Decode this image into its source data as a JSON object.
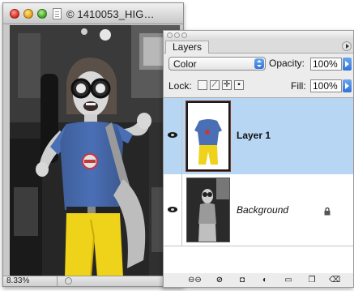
{
  "document": {
    "title": "© 1410053_HIG…",
    "zoom": "8.33%"
  },
  "layers_panel": {
    "tab_label": "Layers",
    "blend_mode": "Color",
    "opacity_label": "Opacity:",
    "opacity_value": "100%",
    "lock_label": "Lock:",
    "fill_label": "Fill:",
    "fill_value": "100%",
    "layers": [
      {
        "name": "Layer 1",
        "selected": true,
        "visible": true
      },
      {
        "name": "Background",
        "selected": false,
        "visible": true,
        "locked": true
      }
    ],
    "footer_buttons": [
      "link-layers",
      "layer-style",
      "layer-mask",
      "adjustment-layer",
      "new-group",
      "new-layer",
      "delete-layer"
    ]
  },
  "colors": {
    "selection": "#b6d6f3",
    "accent_blue": "#3b82e0",
    "shirt_blue": "#4a6fb5",
    "pants_yellow": "#efd21a"
  }
}
